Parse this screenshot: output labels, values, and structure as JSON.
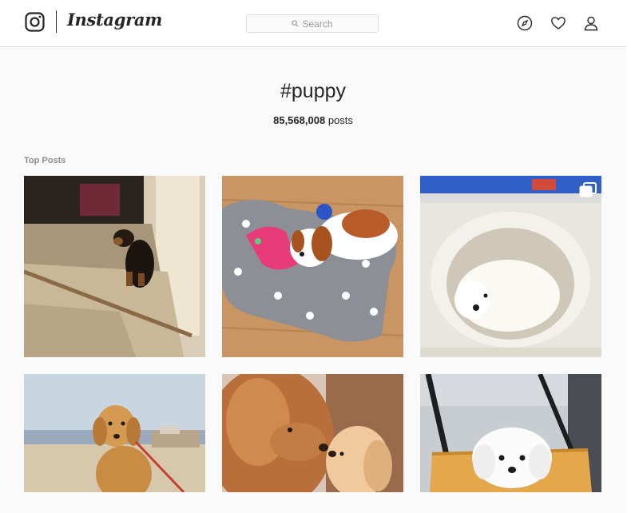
{
  "nav": {
    "logo_icon": "instagram-camera-icon",
    "wordmark": "Instagram",
    "search_placeholder": "Search",
    "icons": [
      "compass-icon",
      "heart-icon",
      "user-icon"
    ]
  },
  "hashtag": {
    "title": "#puppy",
    "post_count": "85,568,008",
    "post_count_suffix": "posts"
  },
  "section": {
    "label": "Top Posts"
  },
  "posts": [
    {
      "subject": "dachshund-on-carpet"
    },
    {
      "subject": "cavalier-with-toy"
    },
    {
      "subject": "white-puppy-in-bin",
      "badge": "multiple-photos-icon"
    },
    {
      "subject": "golden-retriever-on-beach"
    },
    {
      "subject": "spaniels-nose-to-nose"
    },
    {
      "subject": "white-puppy-in-car-seat"
    }
  ],
  "colors": {
    "accent": "#262626",
    "muted": "#8e8e8e",
    "border": "#dbdbdb",
    "background": "#fafafa"
  }
}
